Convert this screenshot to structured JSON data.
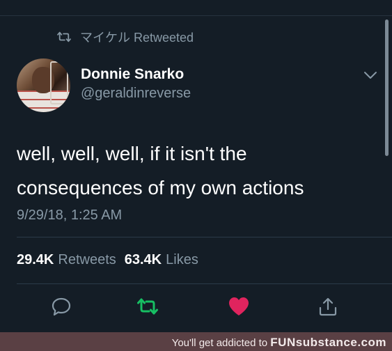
{
  "retweet": {
    "icon": "retweet-icon",
    "text": "マイケル Retweeted"
  },
  "author": {
    "name": "Donnie Snarko",
    "handle": "@geraldinreverse"
  },
  "tweet": {
    "line1": "well, well, well, if it isn't the",
    "line2": "consequences of my own actions",
    "timestamp": "9/29/18, 1:25 AM"
  },
  "stats": {
    "retweets_count": "29.4K",
    "retweets_label": "Retweets",
    "likes_count": "63.4K",
    "likes_label": "Likes"
  },
  "actions": {
    "reply_icon": "reply-icon",
    "retweet_icon": "retweet-icon",
    "like_icon": "heart-icon",
    "share_icon": "share-icon"
  },
  "colors": {
    "background": "#141d26",
    "muted": "#8899a6",
    "retweet_active": "#17bf63",
    "like_active": "#e0245e",
    "banner": "#5a4044"
  },
  "banner": {
    "prefix": "You'll get addicted to",
    "brand_fun": "FUN",
    "brand_rest": "substance.com"
  }
}
